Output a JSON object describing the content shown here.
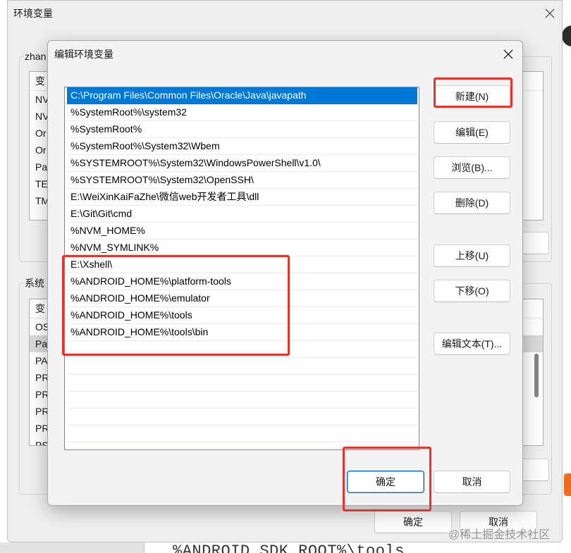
{
  "colors": {
    "selection": "#0078d7",
    "accent": "#0067c0",
    "annotation": "#e8322b"
  },
  "background_window": {
    "title": "环境变量",
    "close_icon": "close-icon",
    "user_group_label": "zhan",
    "user_list_header": "变",
    "user_vars": [
      "NV",
      "NV",
      "Or",
      "Or",
      "Pa",
      "TE",
      "TM"
    ],
    "system_group_label": "系统",
    "system_list_header": "变",
    "system_vars": [
      "OS",
      "Pa",
      "PA",
      "PR",
      "PR",
      "PR",
      "PR",
      "PS"
    ],
    "selected_system_var_index": 1,
    "ok_label": "确定",
    "cancel_label": "取消"
  },
  "dialog": {
    "title": "编辑环境变量",
    "close_icon": "close-icon",
    "entries": [
      "C:\\Program Files\\Common Files\\Oracle\\Java\\javapath",
      "%SystemRoot%\\system32",
      "%SystemRoot%",
      "%SystemRoot%\\System32\\Wbem",
      "%SYSTEMROOT%\\System32\\WindowsPowerShell\\v1.0\\",
      "%SYSTEMROOT%\\System32\\OpenSSH\\",
      "E:\\WeiXinKaiFaZhe\\微信web开发者工具\\dll",
      "E:\\Git\\Git\\cmd",
      "%NVM_HOME%",
      "%NVM_SYMLINK%",
      "E:\\Xshell\\",
      "%ANDROID_HOME%\\platform-tools",
      "%ANDROID_HOME%\\emulator",
      "%ANDROID_HOME%\\tools",
      "%ANDROID_HOME%\\tools\\bin"
    ],
    "selected_entry_index": 0,
    "buttons": {
      "new": "新建(N)",
      "edit": "编辑(E)",
      "browse": "浏览(B)...",
      "delete": "删除(D)",
      "move_up": "上移(U)",
      "move_down": "下移(O)",
      "edit_text": "编辑文本(T)..."
    },
    "ok_label": "确定",
    "cancel_label": "取消"
  },
  "background_page": {
    "text": "%ANDROID_SDK_ROOT%\\tools"
  },
  "watermark": "@稀土掘金技术社区"
}
